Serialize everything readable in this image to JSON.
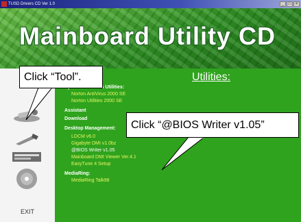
{
  "window": {
    "title": "TUSD Drivers CD Ver 1.0"
  },
  "banner": {
    "title": "Mainboard Utility CD"
  },
  "main": {
    "heading": "Utilities:",
    "menu": [
      {
        "label": "System AntiVirus Utilities:",
        "kind": "cat"
      },
      {
        "label": "Norton AntiVirus 2000 SE",
        "kind": "item"
      },
      {
        "label": "Norton Utilities 2000 SE",
        "kind": "item"
      },
      {
        "label": "Assistant",
        "kind": "cat"
      },
      {
        "label": "Download",
        "kind": "cat"
      },
      {
        "label": "Desktop Management:",
        "kind": "cat"
      },
      {
        "label": "LDCM v6.0",
        "kind": "item"
      },
      {
        "label": "Gigabyte DMI v1.0bz",
        "kind": "item"
      },
      {
        "label": "@BIOS Writer v1.05",
        "kind": "item"
      },
      {
        "label": "Mainboard DMI Viewer Ver.4.1",
        "kind": "item"
      },
      {
        "label": "EasyTune 4 Setup",
        "kind": "item"
      },
      {
        "label": "MediaRing:",
        "kind": "cat"
      },
      {
        "label": "MediaRing Talk98",
        "kind": "item"
      }
    ]
  },
  "sidebar": {
    "icons": [
      "wrench-icon",
      "tool-icon",
      "magazine-icon",
      "cd-icon"
    ],
    "exit_label": "EXIT"
  },
  "callouts": {
    "tool": "Click “Tool”.",
    "bios": "Click “@BIOS Writer v1.05”"
  }
}
